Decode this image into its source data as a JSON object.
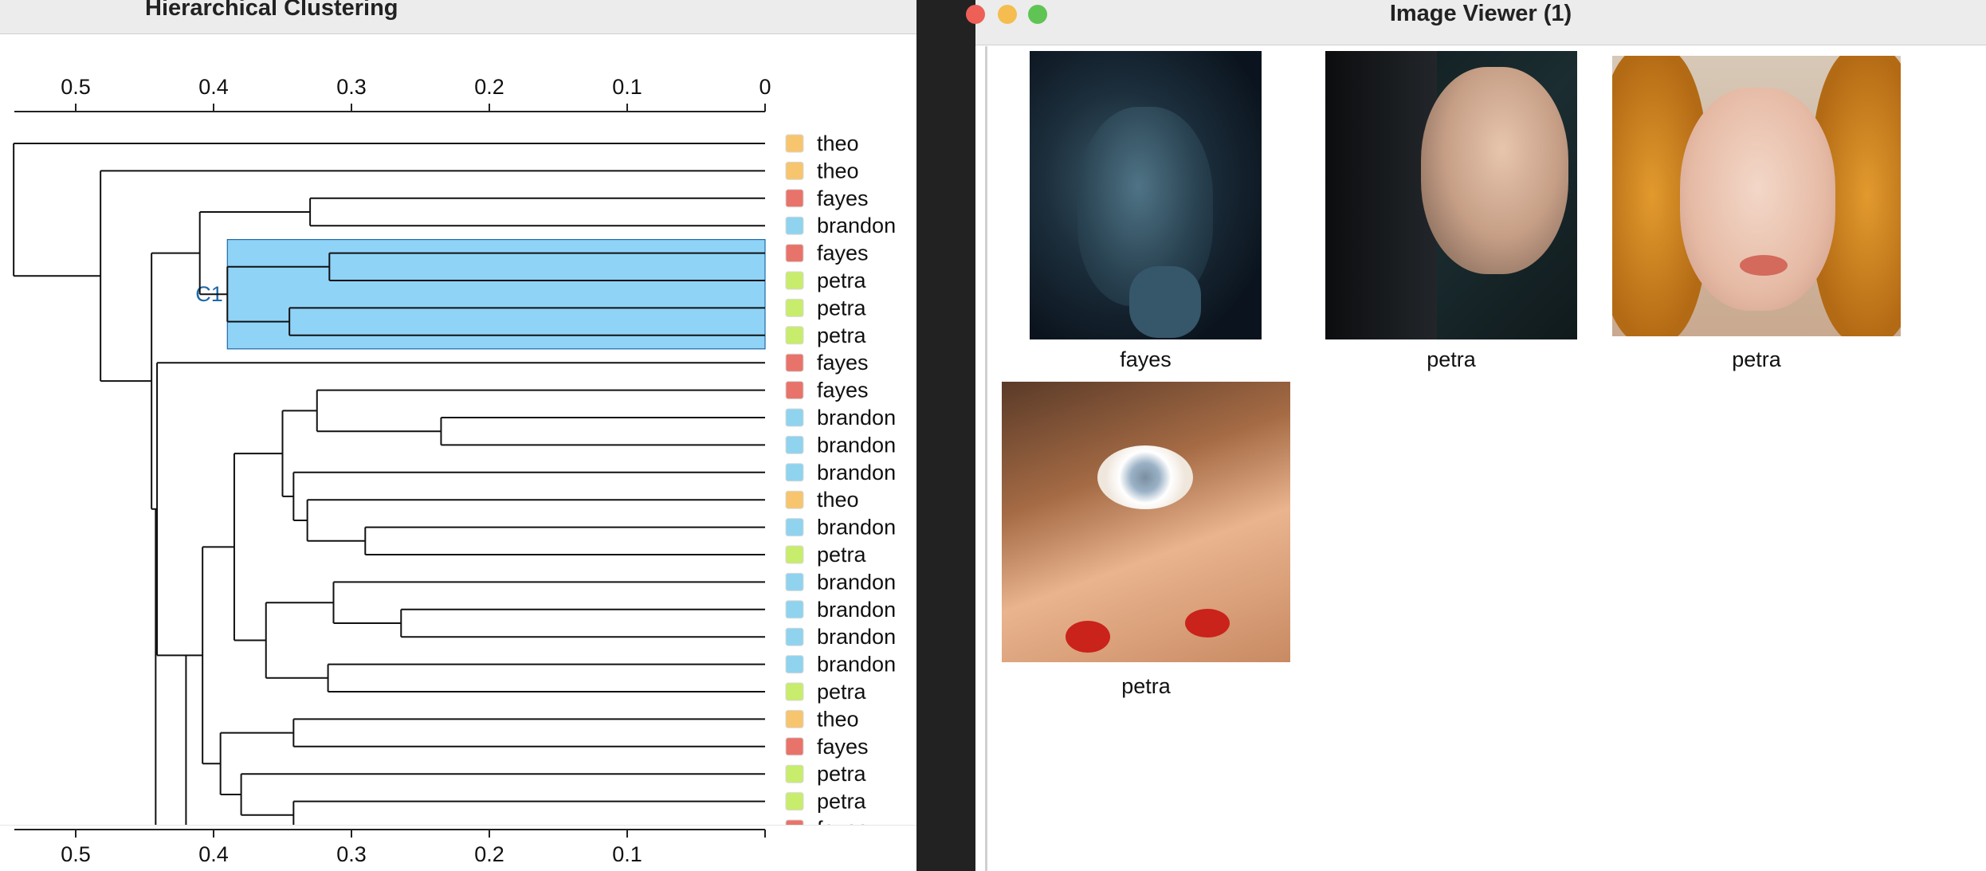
{
  "clustering": {
    "window_title": "Hierarchical Clustering",
    "axis_ticks": [
      "0.5",
      "0.4",
      "0.3",
      "0.2",
      "0.1",
      "0"
    ],
    "bottom_axis_ticks": [
      "0.5",
      "0.4",
      "0.3",
      "0.2",
      "0.1"
    ],
    "cluster_label": "C1",
    "colors": {
      "theo": "#f6c56e",
      "fayes": "#e8736a",
      "brandon": "#8fd3ef",
      "petra": "#c8ec6c",
      "highlight": "#8fd3f7",
      "highlight_stroke": "#1e6aa8"
    },
    "leaves": [
      {
        "label": "theo",
        "group": "theo"
      },
      {
        "label": "theo",
        "group": "theo"
      },
      {
        "label": "fayes",
        "group": "fayes"
      },
      {
        "label": "brandon",
        "group": "brandon"
      },
      {
        "label": "fayes",
        "group": "fayes"
      },
      {
        "label": "petra",
        "group": "petra"
      },
      {
        "label": "petra",
        "group": "petra"
      },
      {
        "label": "petra",
        "group": "petra"
      },
      {
        "label": "fayes",
        "group": "fayes"
      },
      {
        "label": "fayes",
        "group": "fayes"
      },
      {
        "label": "brandon",
        "group": "brandon"
      },
      {
        "label": "brandon",
        "group": "brandon"
      },
      {
        "label": "brandon",
        "group": "brandon"
      },
      {
        "label": "theo",
        "group": "theo"
      },
      {
        "label": "brandon",
        "group": "brandon"
      },
      {
        "label": "petra",
        "group": "petra"
      },
      {
        "label": "brandon",
        "group": "brandon"
      },
      {
        "label": "brandon",
        "group": "brandon"
      },
      {
        "label": "brandon",
        "group": "brandon"
      },
      {
        "label": "brandon",
        "group": "brandon"
      },
      {
        "label": "petra",
        "group": "petra"
      },
      {
        "label": "theo",
        "group": "theo"
      },
      {
        "label": "fayes",
        "group": "fayes"
      },
      {
        "label": "petra",
        "group": "petra"
      },
      {
        "label": "petra",
        "group": "petra"
      },
      {
        "label": "fayes",
        "group": "fayes"
      }
    ]
  },
  "viewer": {
    "window_title": "Image Viewer (1)",
    "images": [
      {
        "caption": "fayes"
      },
      {
        "caption": "petra"
      },
      {
        "caption": "petra"
      },
      {
        "caption": "petra"
      }
    ]
  }
}
